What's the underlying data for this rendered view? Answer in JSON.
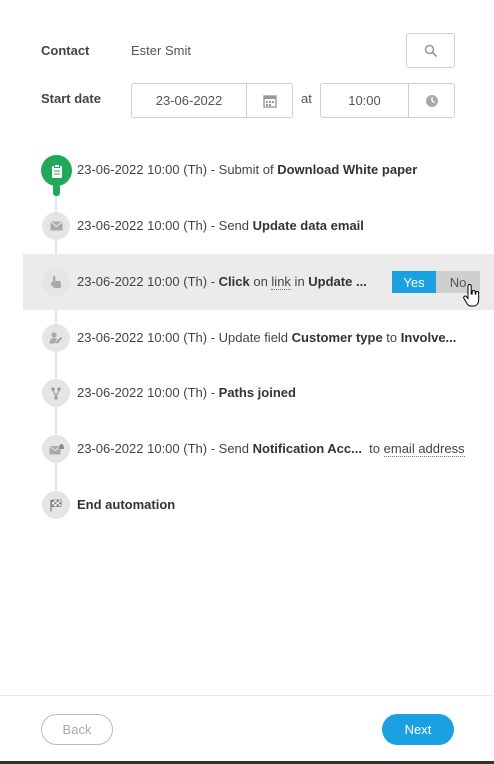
{
  "contact": {
    "label": "Contact",
    "value": "Ester Smit",
    "search_icon": "search-icon"
  },
  "start": {
    "label": "Start date",
    "date": "23-06-2022",
    "at": "at",
    "time": "10:00",
    "calendar_icon": "calendar-icon",
    "clock_icon": "clock-icon"
  },
  "steps": [
    {
      "icon": "clipboard-icon",
      "prefix": "23-06-2022 10:00 (Th)",
      "sep": " - ",
      "pre": "Submit of ",
      "bold": "Download White paper"
    },
    {
      "icon": "envelope-icon",
      "prefix": "23-06-2022 10:00 (Th)",
      "sep": " - ",
      "pre": "Send ",
      "bold": "Update data email"
    },
    {
      "icon": "hand-pointer-icon",
      "prefix": "23-06-2022 10:00 (Th)",
      "sep": " - ",
      "bold1": "Click",
      "mid1": " on ",
      "link": "link",
      "mid2": " in ",
      "bold2": "Update ...",
      "yes": "Yes",
      "no": "No"
    },
    {
      "icon": "user-edit-icon",
      "prefix": "23-06-2022 10:00 (Th)",
      "sep": " - ",
      "pre": "Update field ",
      "bold1": "Customer type",
      "mid": " to ",
      "bold2": "Involve..."
    },
    {
      "icon": "branch-icon",
      "prefix": "23-06-2022 10:00 (Th)",
      "sep": " - ",
      "bold": "Paths joined"
    },
    {
      "icon": "envelope-bell-icon",
      "prefix": "23-06-2022 10:00 (Th)",
      "sep": " - ",
      "pre": "Send ",
      "bold": "Notification Acc...",
      "mid": "  to ",
      "link": "email address"
    },
    {
      "icon": "finish-flag-icon",
      "bold": "End automation"
    }
  ],
  "footer": {
    "back": "Back",
    "next": "Next"
  },
  "colors": {
    "accent": "#1ba1e2",
    "success": "#21a85a"
  }
}
